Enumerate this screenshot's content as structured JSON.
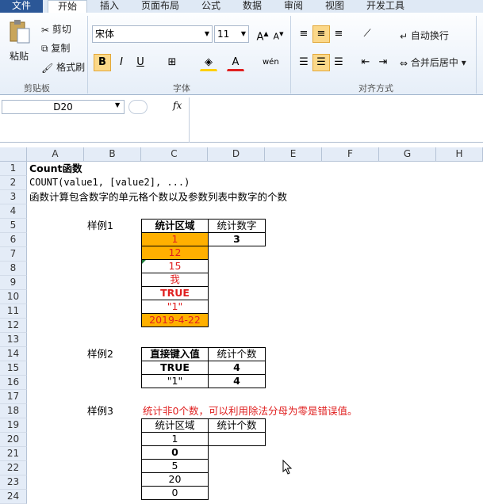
{
  "tabs": [
    "文件",
    "开始",
    "插入",
    "页面布局",
    "公式",
    "数据",
    "审阅",
    "视图",
    "开发工具"
  ],
  "clipboard": {
    "paste": "粘贴",
    "cut": "剪切",
    "copy": "复制",
    "format_painter": "格式刷",
    "group": "剪贴板"
  },
  "font": {
    "name": "宋体",
    "size": "11",
    "group": "字体"
  },
  "alignment": {
    "wrap": "自动换行",
    "merge": "合并后居中",
    "group": "对齐方式"
  },
  "namebox": "D20",
  "fx": "fx",
  "columns": [
    "A",
    "B",
    "C",
    "D",
    "E",
    "F",
    "G",
    "H"
  ],
  "rows": [
    "1",
    "2",
    "3",
    "4",
    "5",
    "6",
    "7",
    "8",
    "9",
    "10",
    "11",
    "12",
    "13",
    "14",
    "15",
    "16",
    "17",
    "18",
    "19",
    "20",
    "21",
    "22",
    "23",
    "24"
  ],
  "cells": {
    "a1": "Count函数",
    "a2": "COUNT(value1, [value2], ...)",
    "a3": "函数计算包含数字的单元格个数以及参数列表中数字的个数",
    "ex1": "样例1",
    "ex1_h1": "统计区域",
    "ex1_h2": "统计数字",
    "ex1_result": "3",
    "ex1_vals": [
      "1",
      "12",
      "15",
      "我",
      "TRUE",
      "\"1\"",
      "2019-4-22"
    ],
    "ex2": "样例2",
    "ex2_h1": "直接键入值",
    "ex2_h2": "统计个数",
    "ex2_r1a": "TRUE",
    "ex2_r1b": "4",
    "ex2_r2a": "\"1\"",
    "ex2_r2b": "4",
    "ex3": "样例3",
    "ex3_note": "统计非0个数，可以利用除法分母为零是错误值。",
    "ex3_h1": "统计区域",
    "ex3_h2": "统计个数",
    "ex3_vals": [
      "1",
      "0",
      "5",
      "20",
      "0"
    ]
  }
}
